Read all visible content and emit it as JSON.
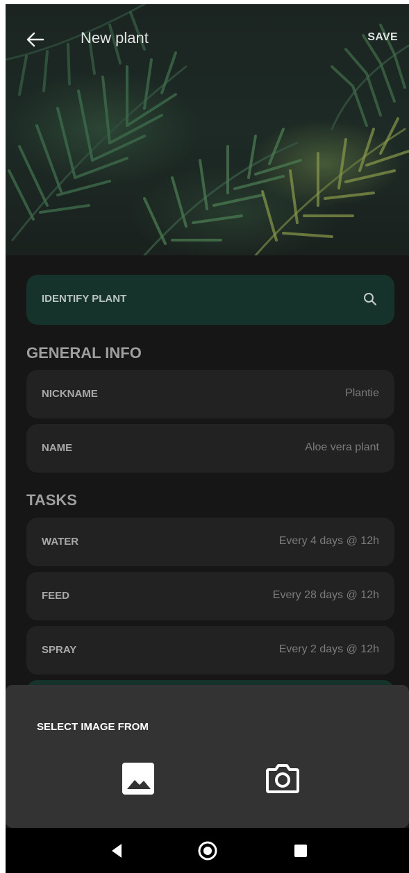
{
  "header": {
    "title": "New plant",
    "save_label": "SAVE",
    "back_icon": "arrow-left-icon"
  },
  "identify": {
    "label": "IDENTIFY PLANT",
    "icon": "search-icon"
  },
  "general_info": {
    "title": "GENERAL INFO",
    "rows": [
      {
        "key": "NICKNAME",
        "value": "Plantie"
      },
      {
        "key": "NAME",
        "value": "Aloe vera plant"
      }
    ]
  },
  "tasks": {
    "title": "TASKS",
    "rows": [
      {
        "key": "WATER",
        "value": "Every 4 days @ 12h"
      },
      {
        "key": "FEED",
        "value": "Every 28 days @ 12h"
      },
      {
        "key": "SPRAY",
        "value": "Every 2 days @ 12h"
      }
    ]
  },
  "bottom_sheet": {
    "title": "SELECT IMAGE FROM",
    "options": [
      {
        "icon": "gallery-image-icon"
      },
      {
        "icon": "camera-icon"
      }
    ]
  },
  "nav": {
    "icons": [
      "back-triangle-icon",
      "home-circle-icon",
      "recents-square-icon"
    ]
  },
  "colors": {
    "background": "#161616",
    "card": "#222222",
    "accent_card": "#15332b",
    "sheet": "#333333"
  }
}
